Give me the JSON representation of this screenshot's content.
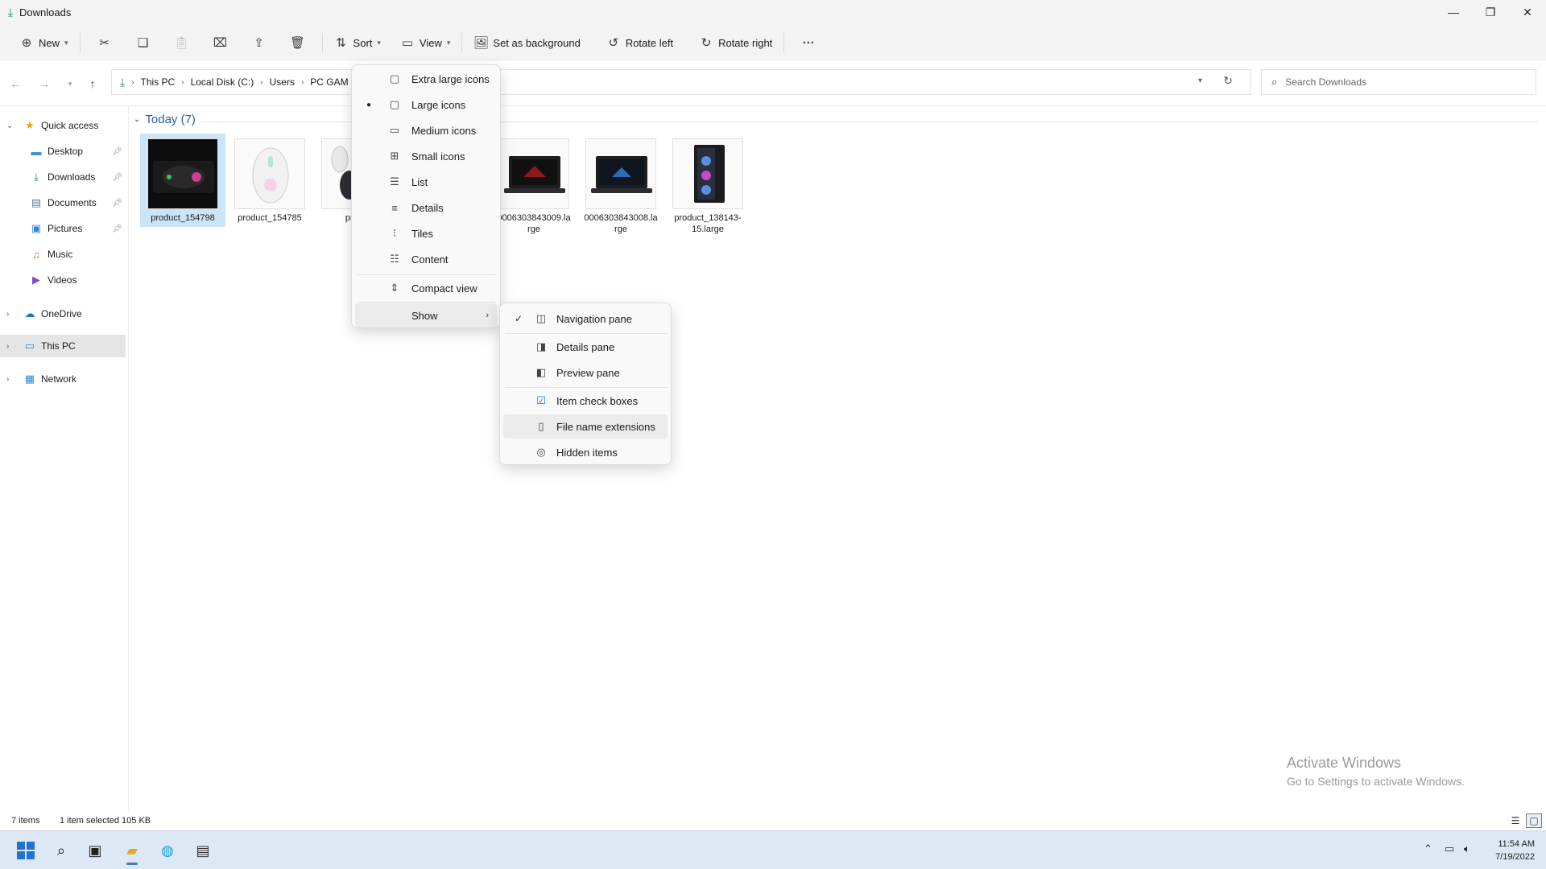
{
  "window": {
    "title": "Downloads",
    "controls": [
      "minimize-icon",
      "restore-icon",
      "close-icon"
    ]
  },
  "toolbar": {
    "new_label": "New",
    "sort_label": "Sort",
    "view_label": "View",
    "set_background_label": "Set as background",
    "rotate_left_label": "Rotate left",
    "rotate_right_label": "Rotate right",
    "more_label": "···"
  },
  "address": {
    "crumbs": [
      "This PC",
      "Local Disk (C:)",
      "Users",
      "PC GAM"
    ],
    "search_placeholder": "Search Downloads"
  },
  "navpane": {
    "quick_access": "Quick access",
    "items": [
      {
        "label": "Desktop",
        "icon": "desktop-icon",
        "pinned": true
      },
      {
        "label": "Downloads",
        "icon": "download-icon",
        "pinned": true
      },
      {
        "label": "Documents",
        "icon": "documents-icon",
        "pinned": true
      },
      {
        "label": "Pictures",
        "icon": "pictures-icon",
        "pinned": true
      },
      {
        "label": "Music",
        "icon": "music-icon",
        "pinned": false
      },
      {
        "label": "Videos",
        "icon": "videos-icon",
        "pinned": false
      }
    ],
    "onedrive": "OneDrive",
    "this_pc": "This PC",
    "network": "Network"
  },
  "content": {
    "group_header": "Today (7)",
    "files": [
      {
        "name": "product_154798",
        "selected": true
      },
      {
        "name": "product_154785",
        "selected": false
      },
      {
        "name": "produ",
        "selected": false
      },
      {
        "name": "0006303843009.la rge",
        "selected": false
      },
      {
        "name": "0006303843008.la rge",
        "selected": false
      },
      {
        "name": "product_138143-15.large",
        "selected": false
      }
    ]
  },
  "view_menu": {
    "items": [
      {
        "label": "Extra large icons",
        "icon": "extra-large-icons-icon"
      },
      {
        "label": "Large icons",
        "icon": "large-icons-icon",
        "selected": true
      },
      {
        "label": "Medium icons",
        "icon": "medium-icons-icon"
      },
      {
        "label": "Small icons",
        "icon": "small-icons-icon"
      },
      {
        "label": "List",
        "icon": "list-icon"
      },
      {
        "label": "Details",
        "icon": "details-icon"
      },
      {
        "label": "Tiles",
        "icon": "tiles-icon"
      },
      {
        "label": "Content",
        "icon": "content-icon"
      },
      {
        "label": "Compact view",
        "icon": "compact-view-icon"
      }
    ],
    "show_label": "Show"
  },
  "show_menu": {
    "items": [
      {
        "label": "Navigation pane",
        "checked": true,
        "icon": "navigation-pane-icon"
      },
      {
        "label": "Details pane",
        "checked": false,
        "icon": "details-pane-icon"
      },
      {
        "label": "Preview pane",
        "checked": false,
        "icon": "preview-pane-icon"
      },
      {
        "label": "Item check boxes",
        "checked": false,
        "icon": "item-check-boxes-icon"
      },
      {
        "label": "File name extensions",
        "checked": false,
        "icon": "file-name-extensions-icon",
        "hover": true
      },
      {
        "label": "Hidden items",
        "checked": false,
        "icon": "hidden-items-icon"
      }
    ]
  },
  "status": {
    "items_count": "7 items",
    "selection": "1 item selected  105 KB"
  },
  "watermark": {
    "line1": "Activate Windows",
    "line2": "Go to Settings to activate Windows."
  },
  "taskbar": {
    "time": "11:54 AM",
    "date": "7/19/2022",
    "accent": "#3a7ccc"
  }
}
